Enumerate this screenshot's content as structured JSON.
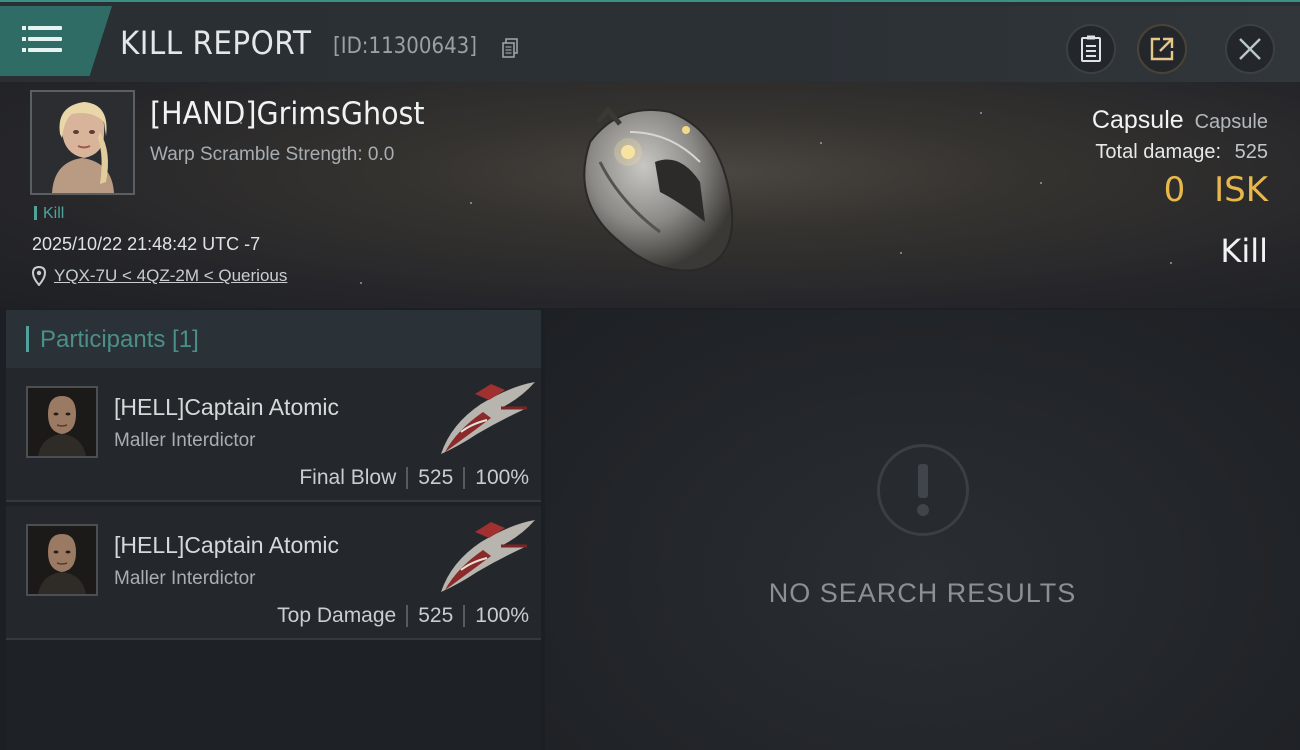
{
  "header": {
    "title": "KILL REPORT",
    "report_id": "[ID:11300643]"
  },
  "victim": {
    "name": "[HAND]GrimsGhost",
    "warp_scramble": "Warp Scramble Strength: 0.0",
    "tag": "Kill",
    "timestamp": "2025/10/22 21:48:42 UTC -7",
    "location": "YQX-7U < 4QZ-2M < Querious",
    "ship_name": "Capsule",
    "ship_class": "Capsule",
    "total_damage_label": "Total damage:",
    "total_damage": "525",
    "isk_value": "0",
    "isk_unit": "ISK",
    "result": "Kill"
  },
  "participants": {
    "title": "Participants [1]",
    "items": [
      {
        "name": "[HELL]Captain Atomic",
        "ship": "Maller Interdictor",
        "role": "Final Blow",
        "damage": "525",
        "percent": "100%"
      },
      {
        "name": "[HELL]Captain Atomic",
        "ship": "Maller Interdictor",
        "role": "Top Damage",
        "damage": "525",
        "percent": "100%"
      }
    ]
  },
  "results_panel": {
    "empty_text": "NO SEARCH RESULTS"
  },
  "colors": {
    "accent": "#3b8f86",
    "isk": "#e8b84a"
  }
}
